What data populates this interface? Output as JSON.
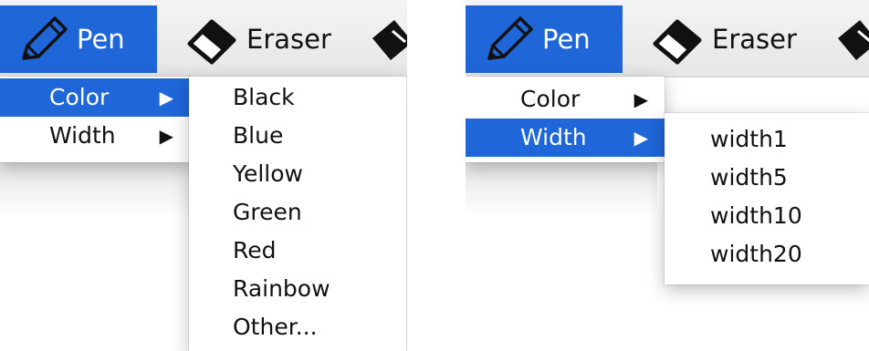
{
  "left_panel": {
    "toolbar": {
      "pen_label": "Pen",
      "eraser_label": "Eraser"
    },
    "menu": {
      "items": [
        {
          "label": "Color"
        },
        {
          "label": "Width"
        }
      ]
    },
    "submenu": {
      "items": [
        "Black",
        "Blue",
        "Yellow",
        "Green",
        "Red",
        "Rainbow",
        "Other..."
      ]
    }
  },
  "right_panel": {
    "toolbar": {
      "pen_label": "Pen",
      "eraser_label": "Eraser"
    },
    "menu": {
      "items": [
        {
          "label": "Color"
        },
        {
          "label": "Width"
        }
      ]
    },
    "submenu": {
      "items": [
        "width1",
        "width5",
        "width10",
        "width20"
      ]
    }
  },
  "arrow_glyph": "▶",
  "icons": {
    "pen": "pencil-icon",
    "eraser": "eraser-icon",
    "third": "bucket-icon"
  },
  "colors": {
    "selection": "#1f66d9",
    "menu_bg": "#ffffff",
    "toolbar_bg": "#ececec"
  }
}
